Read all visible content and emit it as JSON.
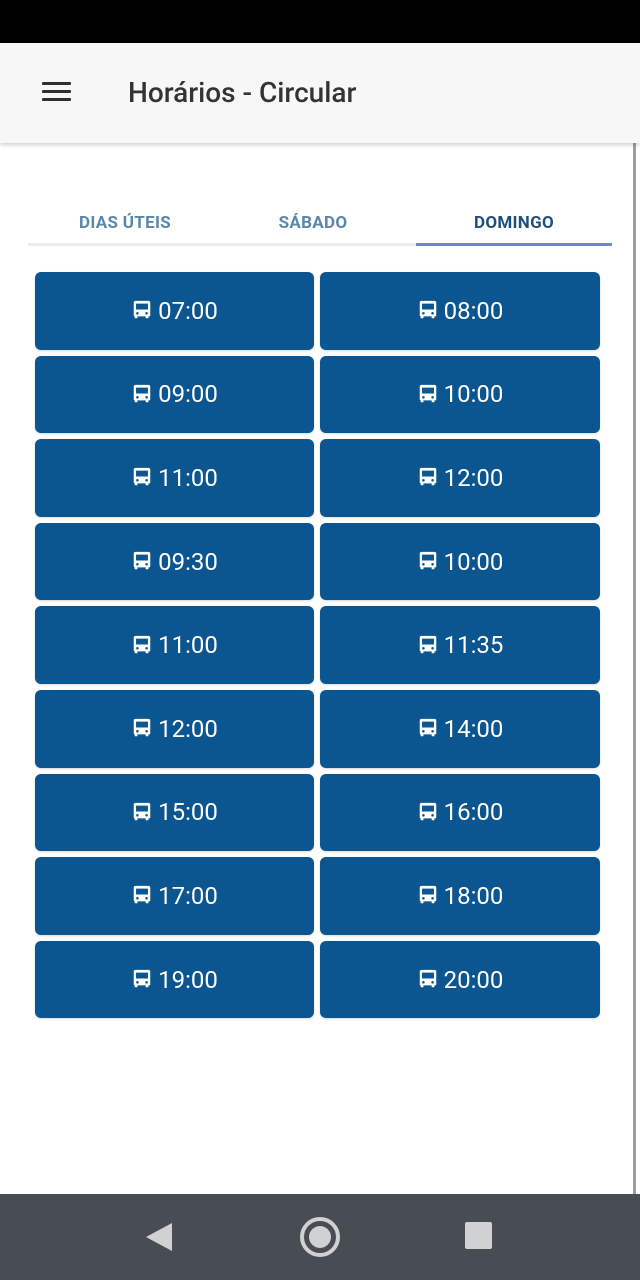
{
  "app_bar": {
    "title": "Horários - Circular",
    "menu_icon": "hamburger-menu-icon"
  },
  "tabs": [
    {
      "label": "DIAS ÚTEIS",
      "selected": false
    },
    {
      "label": "SÁBADO",
      "selected": false
    },
    {
      "label": "DOMINGO",
      "selected": true
    }
  ],
  "schedule": {
    "icon": "bus-icon",
    "times": [
      "07:00",
      "08:00",
      "09:00",
      "10:00",
      "11:00",
      "12:00",
      "09:30",
      "10:00",
      "11:00",
      "11:35",
      "12:00",
      "14:00",
      "15:00",
      "16:00",
      "17:00",
      "18:00",
      "19:00",
      "20:00"
    ]
  },
  "colors": {
    "button": "#0b5690",
    "tab_active": "#1d4f7e",
    "tab_inactive": "#5a86ab",
    "tab_indicator": "#5a8fd6"
  },
  "system_nav": {
    "back_icon": "back-triangle-icon",
    "home_icon": "home-circle-icon",
    "recents_icon": "recents-square-icon"
  }
}
